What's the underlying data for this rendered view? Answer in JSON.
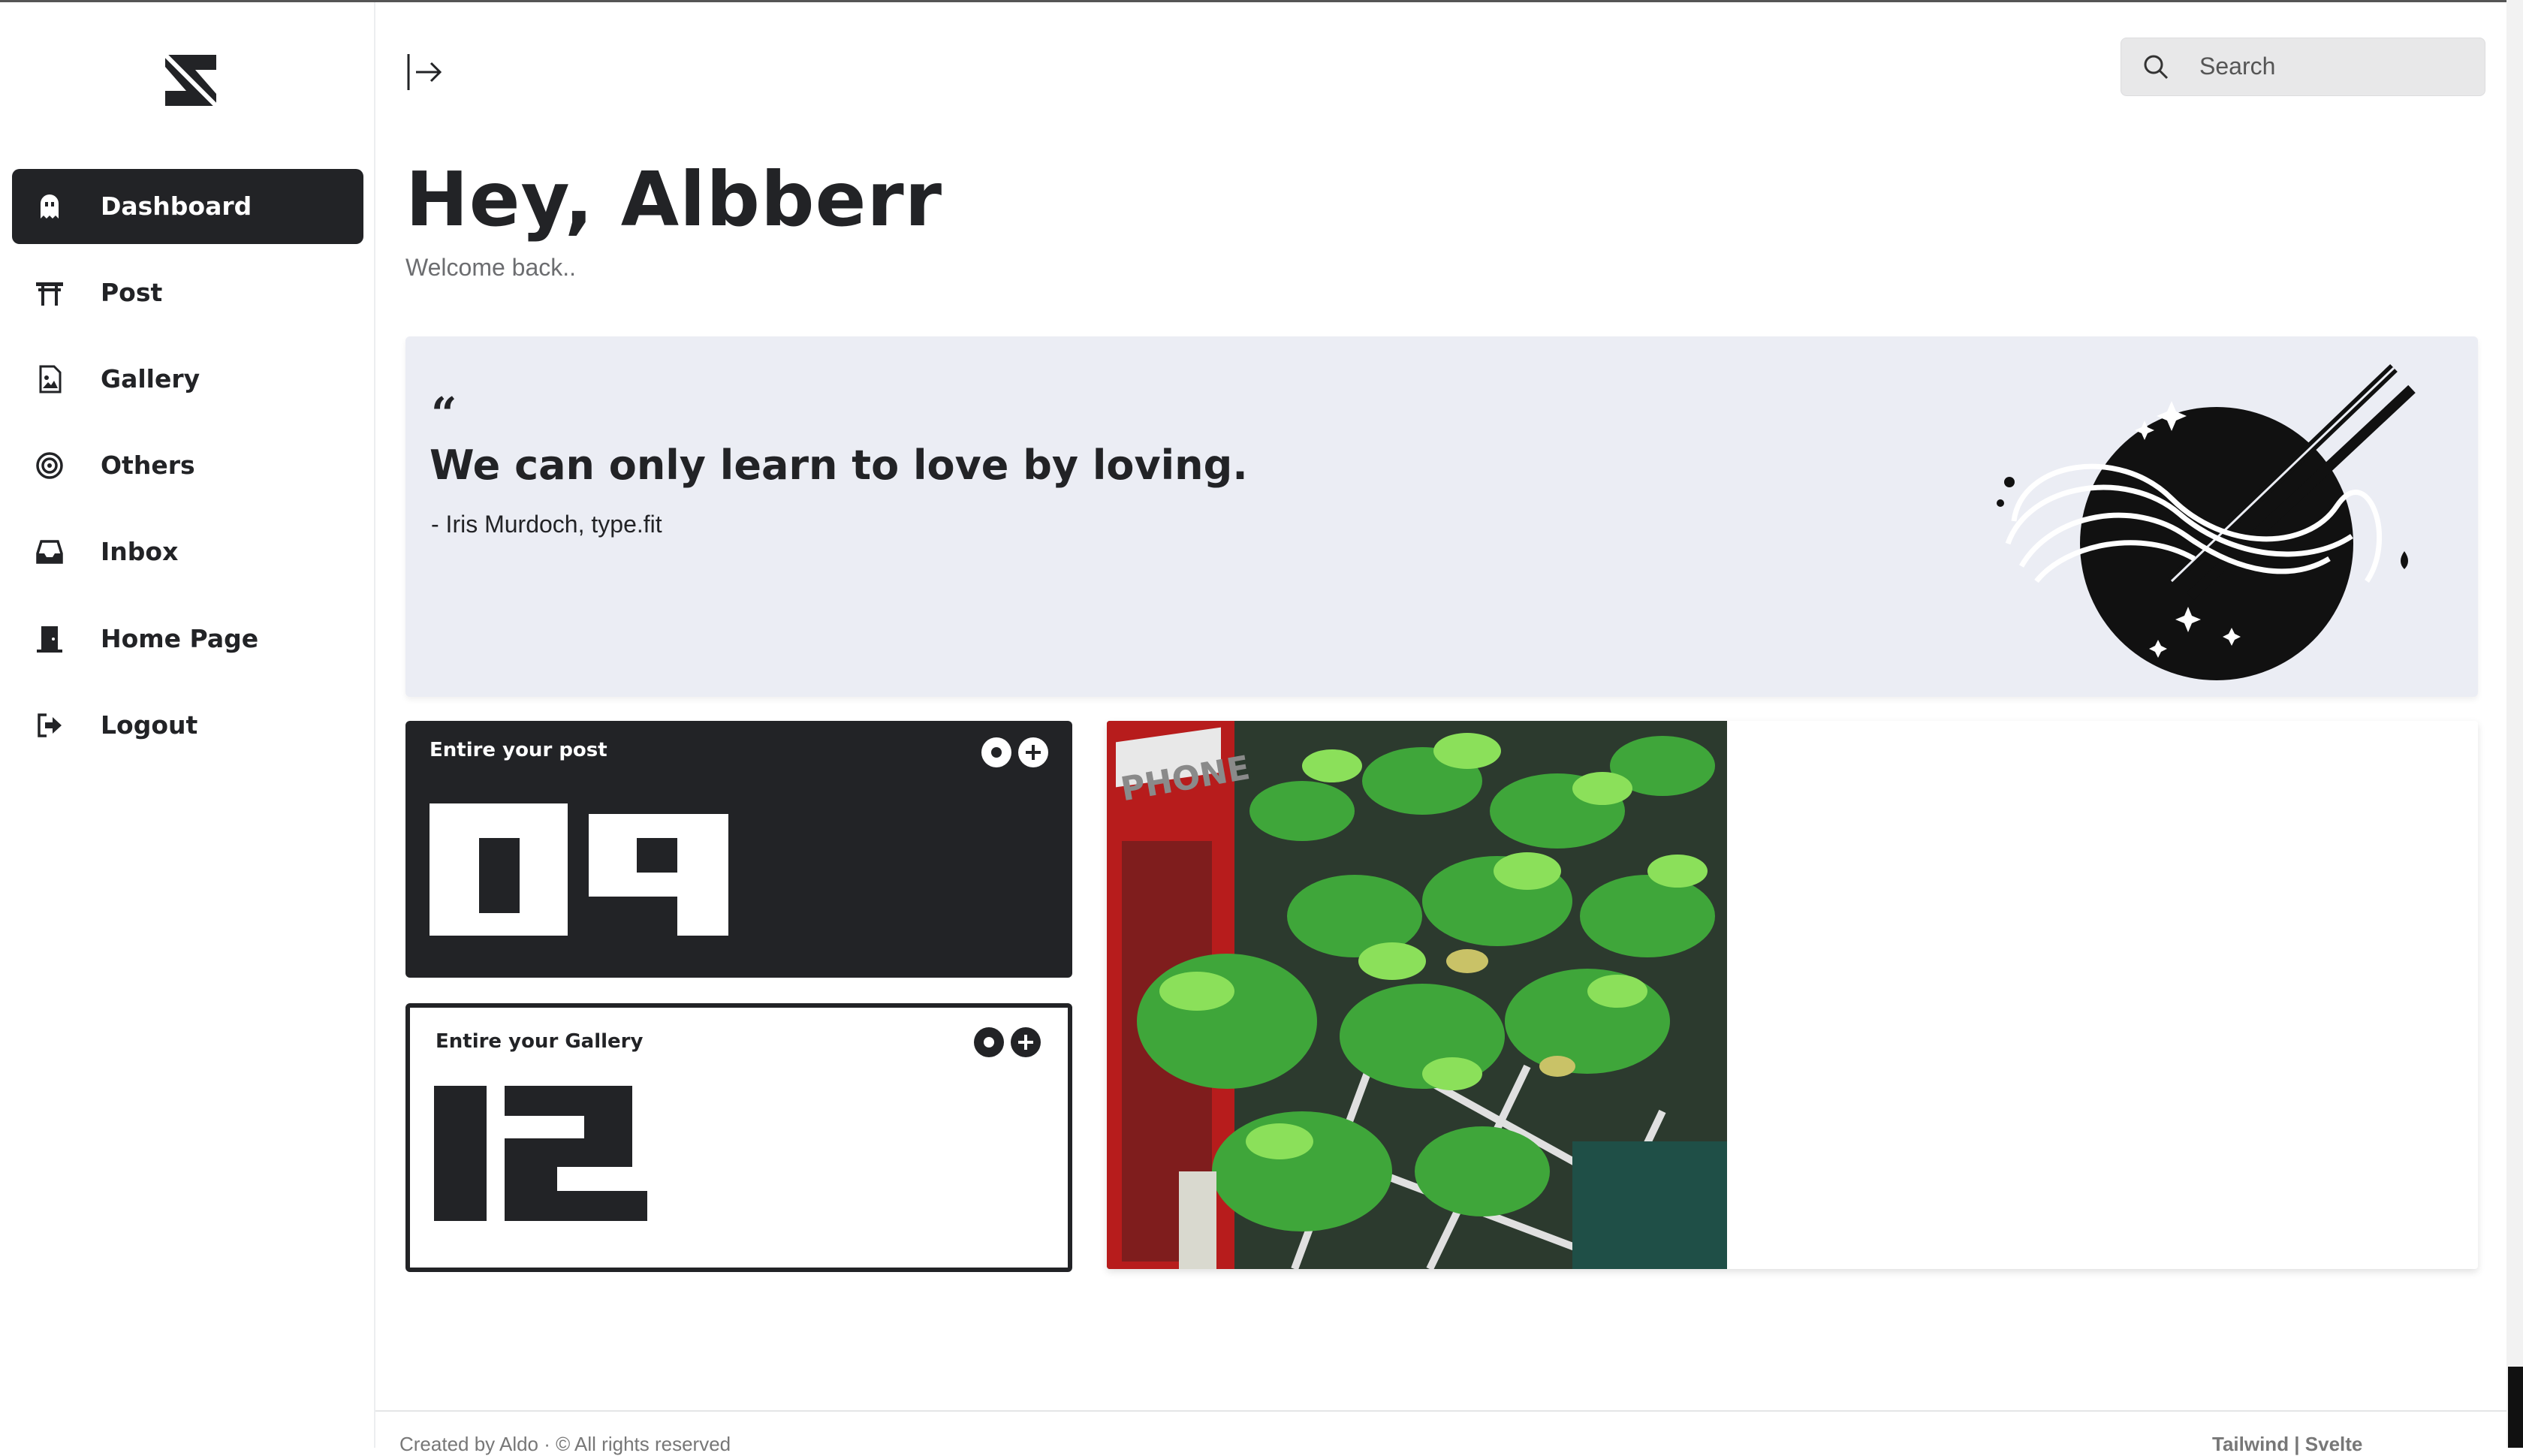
{
  "sidebar": {
    "items": [
      {
        "label": "Dashboard",
        "icon": "ghost-icon",
        "active": true
      },
      {
        "label": "Post",
        "icon": "torii-gate-icon",
        "active": false
      },
      {
        "label": "Gallery",
        "icon": "image-file-icon",
        "active": false
      },
      {
        "label": "Others",
        "icon": "target-icon",
        "active": false
      },
      {
        "label": "Inbox",
        "icon": "inbox-icon",
        "active": false
      },
      {
        "label": "Home Page",
        "icon": "door-icon",
        "active": false
      },
      {
        "label": "Logout",
        "icon": "logout-icon",
        "active": false
      }
    ]
  },
  "header": {
    "search_placeholder": "Search",
    "greeting": "Hey, Albberr",
    "welcome": "Welcome back.."
  },
  "quote": {
    "mark": "“",
    "text": "We can only learn to love by loving.",
    "author": "- Iris Murdoch, type.fit"
  },
  "stats": [
    {
      "title": "Entire your post",
      "value": "09"
    },
    {
      "title": "Entire your Gallery",
      "value": "12"
    }
  ],
  "footer": {
    "left": "Created by Aldo · © All rights reserved",
    "right": "Tailwind | Svelte"
  },
  "colors": {
    "primary": "#222326",
    "quote_bg": "#ebedf4",
    "page_bg": "#ffffff"
  }
}
